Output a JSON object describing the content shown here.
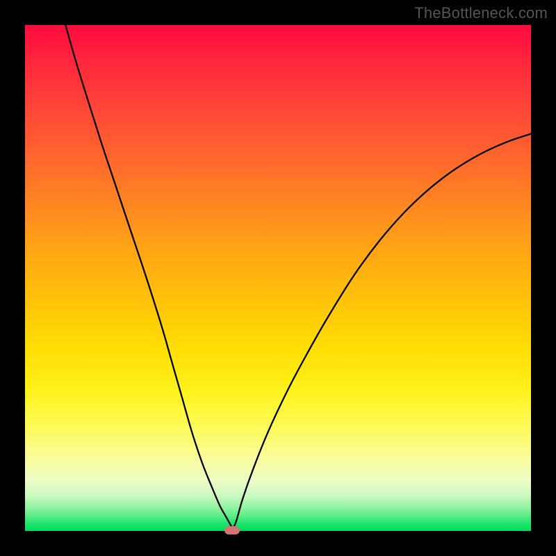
{
  "watermark": "TheBottleneck.com",
  "chart_data": {
    "type": "line",
    "title": "",
    "xlabel": "",
    "ylabel": "",
    "xlim": [
      0,
      100
    ],
    "ylim": [
      0,
      100
    ],
    "series": [
      {
        "name": "curve",
        "x": [
          8,
          10,
          12,
          15,
          18,
          21,
          24,
          27,
          29,
          31,
          33,
          35,
          37,
          38.5,
          39.5,
          40.3,
          40.8,
          41,
          41.2,
          41.8,
          43,
          45,
          48,
          52,
          56,
          60,
          65,
          70,
          75,
          80,
          85,
          90,
          95,
          100
        ],
        "values": [
          100,
          93,
          86.5,
          77,
          68,
          59,
          50,
          40.5,
          33.5,
          26.5,
          19.5,
          13.5,
          8.5,
          5,
          3.2,
          1.8,
          0.9,
          0.4,
          0.7,
          2.1,
          6.3,
          12,
          19.5,
          28,
          35.5,
          42.5,
          50.5,
          57.3,
          63,
          67.7,
          71.5,
          74.5,
          76.8,
          78.5
        ]
      }
    ],
    "marker": {
      "x": 41,
      "y": 0.1
    },
    "annotations": [],
    "grid": false,
    "legend": false
  },
  "colors": {
    "gradient_top": "#ff0a3e",
    "gradient_bottom": "#00d95a",
    "curve": "#000000",
    "marker": "#d7746f",
    "frame": "#000000"
  }
}
